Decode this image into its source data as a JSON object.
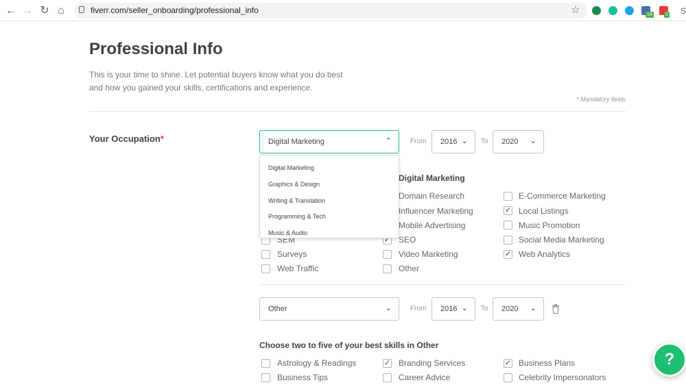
{
  "browser": {
    "url": "fiverr.com/seller_onboarding/professional_info",
    "badge_a": "14",
    "badge_b": "1"
  },
  "page": {
    "title": "Professional Info",
    "desc_line1": "This is your time to shine. Let potential buyers know what you do best",
    "desc_line2": "and how you gained your skills, certifications and experience.",
    "mandatory": "* Mandatory fields"
  },
  "occupation": {
    "label": "Your Occupation",
    "required_mark": "*",
    "selected": "Digital Marketing",
    "from_label": "From",
    "from_value": "2016",
    "to_label": "To",
    "to_value": "2020",
    "dropdown_options": [
      "Digital Marketing",
      "Graphics & Design",
      "Writing & Translation",
      "Programming & Tech",
      "Music & Audio"
    ],
    "skills_heading": "Digital Marketing",
    "skills": [
      {
        "label": "Domain Research",
        "checked": false
      },
      {
        "label": "E-Commerce Marketing",
        "checked": false
      },
      {
        "label": "Influencer Marketing",
        "checked": false
      },
      {
        "label": "Local Listings",
        "checked": true
      },
      {
        "label": "Mobile Advertising",
        "checked": false
      },
      {
        "label": "Music Promotion",
        "checked": false
      },
      {
        "label": "SEM",
        "checked": false
      },
      {
        "label": "SEO",
        "checked": true
      },
      {
        "label": "Social Media Marketing",
        "checked": false
      },
      {
        "label": "Surveys",
        "checked": false
      },
      {
        "label": "Video Marketing",
        "checked": false
      },
      {
        "label": "Web Analytics",
        "checked": true
      },
      {
        "label": "Web Traffic",
        "checked": false
      },
      {
        "label": "Other",
        "checked": false
      }
    ]
  },
  "occupation2": {
    "selected": "Other",
    "from_label": "From",
    "from_value": "2016",
    "to_label": "To",
    "to_value": "2020",
    "skills_heading": "Choose two to five of your best skills in Other",
    "skills": [
      {
        "label": "Astrology & Readings",
        "checked": false
      },
      {
        "label": "Branding Services",
        "checked": true
      },
      {
        "label": "Business Plans",
        "checked": true
      },
      {
        "label": "Business Tips",
        "checked": false
      },
      {
        "label": "Career Advice",
        "checked": false
      },
      {
        "label": "Celebrity Impersonators",
        "checked": false
      }
    ]
  },
  "help_button": "?",
  "colors": {
    "accent": "#1dbf73",
    "required": "#e43c3c"
  }
}
